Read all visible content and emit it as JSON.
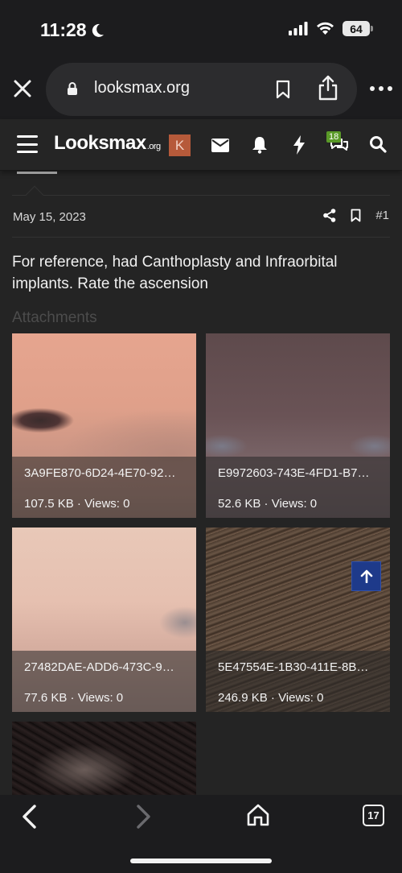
{
  "status_bar": {
    "time": "11:28",
    "battery": "64"
  },
  "browser": {
    "url": "looksmax.org",
    "tab_count": "17"
  },
  "site_nav": {
    "logo_main": "Looksmax",
    "logo_suffix": ".org",
    "avatar_letter": "K",
    "conversations_badge": "18"
  },
  "post": {
    "date": "May 15, 2023",
    "number": "#1",
    "body": "For reference, had Canthoplasty and Infraorbital implants. Rate the ascension",
    "attachments_title": "Attachments",
    "attachments": [
      {
        "filename": "3A9FE870-6D24-4E70-92…",
        "size": "107.5 KB",
        "views": "Views: 0"
      },
      {
        "filename": "E9972603-743E-4FD1-B7…",
        "size": "52.6 KB",
        "views": "Views: 0"
      },
      {
        "filename": "27482DAE-ADD6-473C-9…",
        "size": "77.6 KB",
        "views": "Views: 0"
      },
      {
        "filename": "5E47554E-1B30-411E-8B…",
        "size": "246.9 KB",
        "views": "Views: 0"
      }
    ]
  },
  "colors": {
    "background": "#242424",
    "chrome": "#1c1c1e",
    "avatar": "#b65a3a",
    "badge": "#5a9a28",
    "scroll_top": "#1e3a8a"
  }
}
